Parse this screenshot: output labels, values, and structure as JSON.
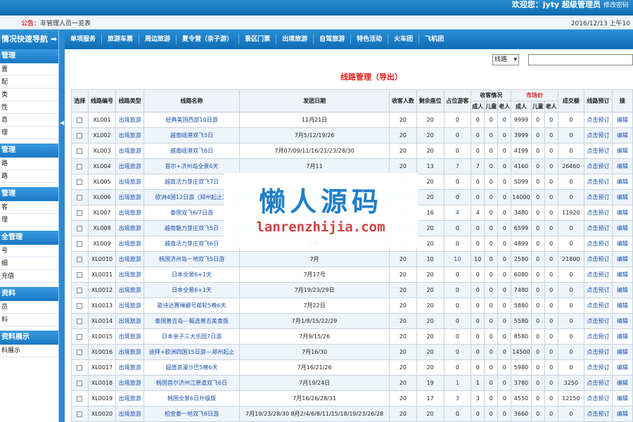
{
  "header": {
    "user_text": "欢迎您：jyty 超级管理员",
    "change_pw": "修改密码"
  },
  "notice": {
    "label": "公告：",
    "text": "非管理人员一览表",
    "datetime": "2016/12/13 上午10"
  },
  "sidebar": {
    "title": "情况快速导航",
    "sections": [
      {
        "title": "管理",
        "items": [
          "置",
          "配",
          "类",
          "性",
          "息",
          "理"
        ]
      },
      {
        "title": "管理",
        "items": [
          "路",
          "路"
        ]
      },
      {
        "title": "管理",
        "items": [
          "客",
          "理"
        ]
      },
      {
        "title": "全管理",
        "items": [
          "号",
          "细",
          "充值"
        ]
      },
      {
        "title": "资料",
        "items": [
          "员",
          "料"
        ]
      },
      {
        "title": "资料展示",
        "items": [
          "料展示"
        ]
      }
    ]
  },
  "menu": [
    "单项服务",
    "旅游车票",
    "周边旅游",
    "夏令营（亲子游）",
    "景区门票",
    "出境旅游",
    "自驾旅游",
    "特色活动",
    "火车团",
    "飞机团"
  ],
  "filter": {
    "select_value": "线路",
    "search_value": ""
  },
  "page": {
    "title": "线路管理（导出）"
  },
  "table": {
    "headers": {
      "select": "选择",
      "code": "线路编号",
      "type": "线路类型",
      "name": "线路名称",
      "date": "发团日期",
      "guests": "收客人数",
      "remaining": "剩余座位",
      "seats": "占位游客",
      "guest_status": "收客情况",
      "market_price": "市场价",
      "deal": "成交额",
      "book": "线路预订",
      "ops": "操"
    },
    "subheaders": [
      "成人",
      "儿童",
      "老人",
      "成人",
      "儿童",
      "老人"
    ],
    "rows": [
      [
        "XL001",
        "出境旅游",
        "经典美国西部10日游",
        "11月21日",
        "20",
        "20",
        "0",
        "0",
        "0",
        "0",
        "9999",
        "0",
        "0",
        "0",
        "点击预订",
        "编辑"
      ],
      [
        "XL002",
        "出境旅游",
        "越南岘港双飞5日",
        "7月5/12/19/26",
        "20",
        "20",
        "0",
        "0",
        "0",
        "0",
        "3999",
        "0",
        "0",
        "0",
        "点击预订",
        "编辑"
      ],
      [
        "XL003",
        "出境旅游",
        "越南岘港双飞6日",
        "7月07/09/11/16/21/23/28/30",
        "20",
        "20",
        "0",
        "0",
        "0",
        "0",
        "4199",
        "0",
        "0",
        "0",
        "点击预订",
        "编辑"
      ],
      [
        "XL004",
        "出境旅游",
        "首尔+济州岛全景6天",
        "7月11",
        "20",
        "13",
        "7",
        "7",
        "0",
        "0",
        "4160",
        "0",
        "0",
        "26460",
        "点击预订",
        "编辑"
      ],
      [
        "XL005",
        "出境旅游",
        "越南活力芽庄双飞7日",
        "",
        "20",
        "20",
        "0",
        "0",
        "0",
        "0",
        "5099",
        "0",
        "0",
        "0",
        "点击预订",
        "编辑"
      ],
      [
        "XL006",
        "出境旅游",
        "欧洲4国12日游（郑州起止）",
        "",
        "20",
        "20",
        "0",
        "0",
        "0",
        "0",
        "14000",
        "0",
        "0",
        "0",
        "点击预订",
        "编辑"
      ],
      [
        "XL007",
        "出境旅游",
        "泰国双飞6/7日游",
        "",
        "20",
        "16",
        "4",
        "4",
        "0",
        "0",
        "3480",
        "0",
        "0",
        "11920",
        "点击预订",
        "编辑"
      ],
      [
        "XL008",
        "出境旅游",
        "越南魅力芽庄双飞5日",
        "",
        "20",
        "20",
        "0",
        "0",
        "0",
        "0",
        "6599",
        "0",
        "0",
        "0",
        "点击预订",
        "编辑"
      ],
      [
        "XL009",
        "出境旅游",
        "越南活力芽庄双飞6日",
        "7月",
        "20",
        "20",
        "0",
        "0",
        "0",
        "0",
        "4899",
        "0",
        "0",
        "0",
        "点击预订",
        "编辑"
      ],
      [
        "XL0010",
        "出境旅游",
        "韩国济州岛一地双飞5日游",
        "7月",
        "20",
        "10",
        "10",
        "10",
        "0",
        "0",
        "2580",
        "0",
        "0",
        "21800",
        "点击预订",
        "编辑"
      ],
      [
        "XL0011",
        "出境旅游",
        "日本全景6+1天",
        "7月17号",
        "20",
        "20",
        "0",
        "0",
        "0",
        "0",
        "6080",
        "0",
        "0",
        "0",
        "点击预订",
        "编辑"
      ],
      [
        "XL0012",
        "出境旅游",
        "日本全景6+1天",
        "7月19/23/29日",
        "20",
        "20",
        "0",
        "0",
        "0",
        "0",
        "7480",
        "0",
        "0",
        "0",
        "点击预订",
        "编辑"
      ],
      [
        "XL0013",
        "出境旅游",
        "歌诗达赛琳娜号邮轮5晚6天",
        "7月22日",
        "20",
        "20",
        "0",
        "0",
        "0",
        "0",
        "5880",
        "0",
        "0",
        "0",
        "点击预订",
        "编辑"
      ],
      [
        "XL0014",
        "出境旅游",
        "泰国普吉岛---甄选普吉美食版",
        "7月1/8/15/22/29",
        "20",
        "20",
        "0",
        "0",
        "0",
        "0",
        "5580",
        "0",
        "0",
        "0",
        "点击预订",
        "编辑"
      ],
      [
        "XL0015",
        "出境旅游",
        "日本亲子三大乐园7日游",
        "7月9/15/26",
        "20",
        "20",
        "0",
        "0",
        "0",
        "0",
        "8580",
        "0",
        "0",
        "0",
        "点击预订",
        "编辑"
      ],
      [
        "XL0016",
        "出境旅游",
        "迪拜+欧洲四国15日游---郑州起止",
        "7月16/30",
        "20",
        "20",
        "0",
        "0",
        "0",
        "0",
        "14500",
        "0",
        "0",
        "0",
        "点击预订",
        "编辑"
      ],
      [
        "XL0017",
        "出境旅游",
        "超值浪漫沙巴5晚6天",
        "7月16/21/26",
        "20",
        "20",
        "0",
        "0",
        "0",
        "0",
        "5980",
        "0",
        "0",
        "0",
        "点击预订",
        "编辑"
      ],
      [
        "XL0018",
        "出境旅游",
        "韩国首尔济州江原道双飞6日",
        "7月19/24日",
        "20",
        "19",
        "1",
        "1",
        "0",
        "0",
        "3780",
        "0",
        "0",
        "3250",
        "点击预订",
        "编辑"
      ],
      [
        "XL0019",
        "出境旅游",
        "韩国全景6日升级版",
        "7月16/26/28/31",
        "20",
        "17",
        "3",
        "3",
        "0",
        "0",
        "4550",
        "0",
        "0",
        "12150",
        "点击预订",
        "编辑"
      ],
      [
        "XL0020",
        "出境旅游",
        "柏金泰一地双飞6日游",
        "7月19/23/28/30 8月2/4/6/8/11/15/18/19/23/26/28",
        "20",
        "20",
        "0",
        "0",
        "0",
        "0",
        "3660",
        "0",
        "0",
        "0",
        "点击预订",
        "编辑"
      ]
    ]
  },
  "watermark": {
    "title": "懒人源码",
    "url": "lanrenzhijia.com"
  }
}
